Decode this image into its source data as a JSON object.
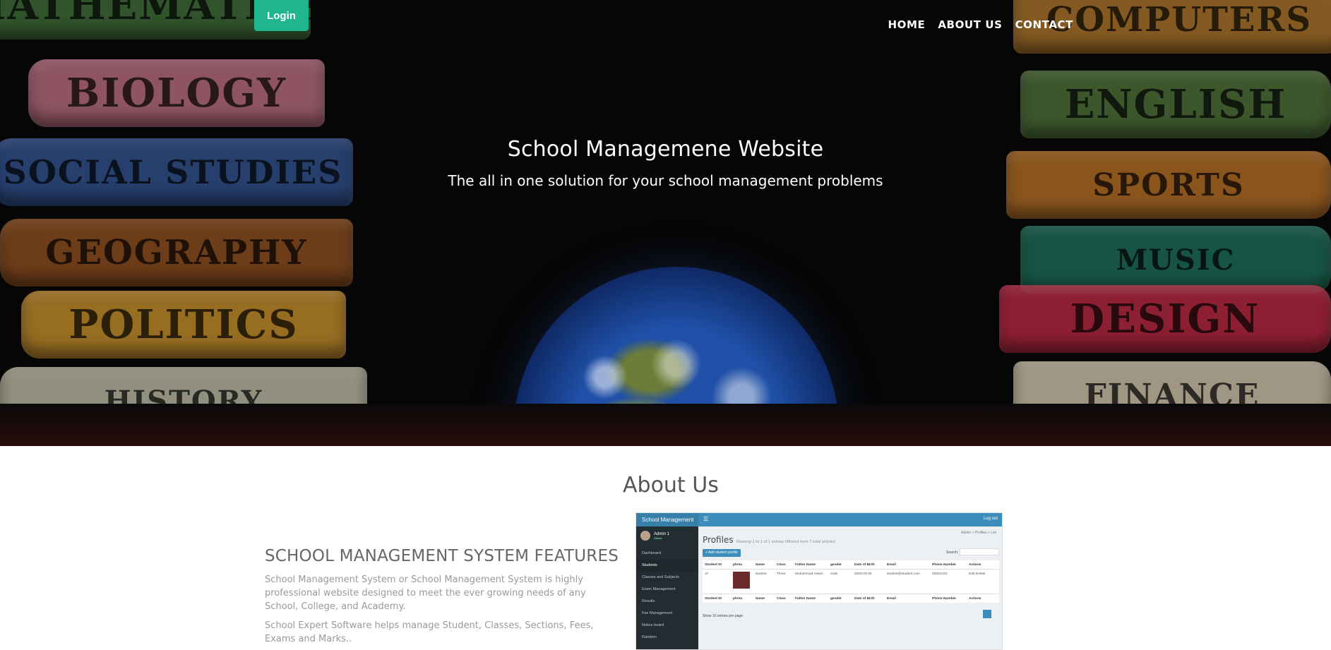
{
  "nav": {
    "login_label": "Login",
    "links": [
      "HOME",
      "ABOUT US",
      "CONTACT"
    ]
  },
  "hero": {
    "title": "School Managemene Website",
    "subtitle": "The all in one solution for your school management problems",
    "books_left": [
      "MATHEMATICS",
      "BIOLOGY",
      "SOCIAL STUDIES",
      "GEOGRAPHY",
      "POLITICS",
      "HISTORY"
    ],
    "books_right": [
      "COMPUTERS",
      "ENGLISH",
      "SPORTS",
      "MUSIC",
      "DESIGN",
      "FINANCE"
    ]
  },
  "about": {
    "title": "About Us",
    "features_title": "SCHOOL MANAGEMENT SYSTEM FEATURES",
    "paragraph1": "School Management System or School Management System is highly professional website designed to meet the ever growing needs of any School, College, and Academy.",
    "paragraph2": "School Expert Software helps manage Student, Classes, Sections, Fees, Exams and Marks.."
  },
  "preview": {
    "brand": "School Management",
    "logout": "Log out",
    "user_name": "Admin 1",
    "user_status": "Online",
    "menu": [
      "Dashboard",
      "Students",
      "Classes and Subjects",
      "Exam Management",
      "Results",
      "Fee Management",
      "Notice board",
      "Random"
    ],
    "active_menu_index": 1,
    "breadcrumb": "Admin > Profiles > List",
    "heading": "Profiles",
    "heading_small": "Showing 1 to 1 of 1 entries (filtered from 7 total entries)",
    "add_button": "+ Add student profile",
    "search_label": "Search:",
    "columns": [
      "Student ID",
      "photo",
      "Name",
      "Class",
      "Father Name",
      "gender",
      "Date of Birth",
      "Email",
      "Phone Number",
      "Actions"
    ],
    "row": [
      "37",
      "",
      "student",
      "Three",
      "Muhammad Aslam",
      "male",
      "2000-03-05",
      "student@student.com",
      "03001234",
      "Edit Delete"
    ],
    "show_entries": "Show 10 entries per page"
  },
  "colors": {
    "login_button": "#1fb58f",
    "preview_header": "#3c8dbc",
    "preview_sidebar": "#222d32"
  }
}
